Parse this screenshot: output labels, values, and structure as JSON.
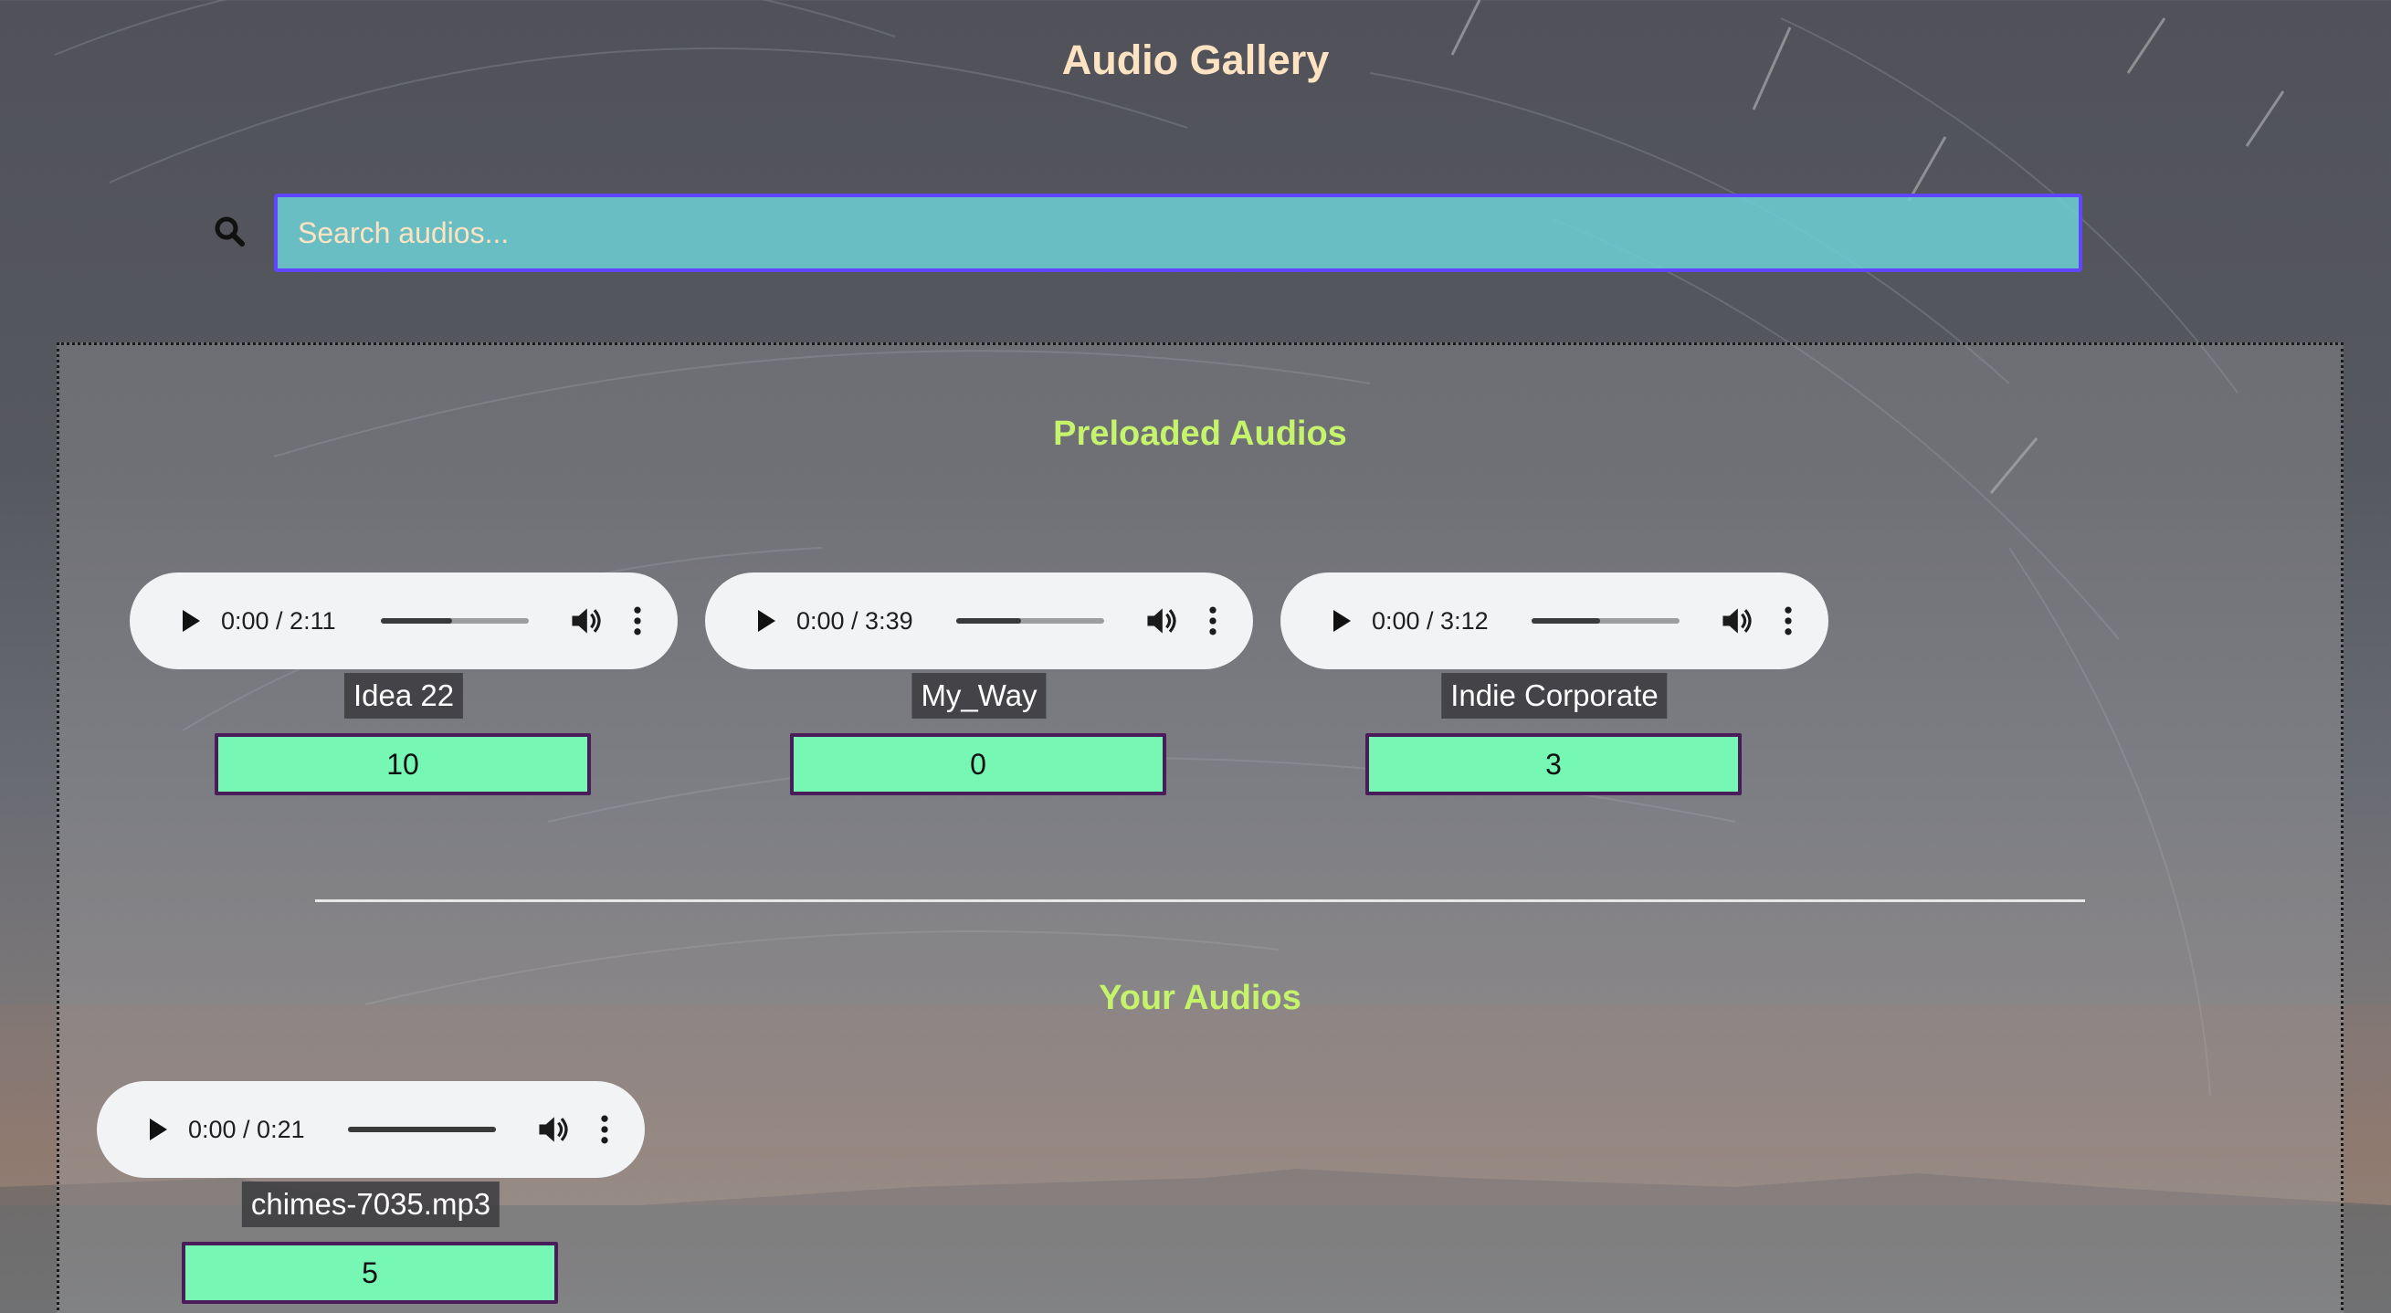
{
  "page": {
    "title": "Audio Gallery"
  },
  "search": {
    "placeholder": "Search audios...",
    "value": ""
  },
  "preloaded": {
    "title": "Preloaded Audios",
    "items": [
      {
        "name": "Idea 22",
        "time": "0:00 / 2:11",
        "count": "10",
        "buffered": 0.48
      },
      {
        "name": "My_Way",
        "time": "0:00 / 3:39",
        "count": "0",
        "buffered": 0.44
      },
      {
        "name": "Indie Corporate",
        "time": "0:00 / 3:12",
        "count": "3",
        "buffered": 0.46
      }
    ]
  },
  "yours": {
    "title": "Your Audios",
    "items": [
      {
        "name": "chimes-7035.mp3",
        "time": "0:00 / 0:21",
        "count": "5",
        "buffered": 1.0
      }
    ]
  },
  "colors": {
    "title": "#fde3c1",
    "section_title": "#c5f36c",
    "search_bg": "#6ccdd3",
    "search_border": "#6146ff",
    "count_bg": "#76f7b3",
    "count_border": "#4a1d5a",
    "player_bg": "#f1f3f4"
  },
  "icons": {
    "search": "search-icon",
    "play": "play-icon",
    "volume": "volume-icon",
    "menu": "more-vert-icon"
  }
}
